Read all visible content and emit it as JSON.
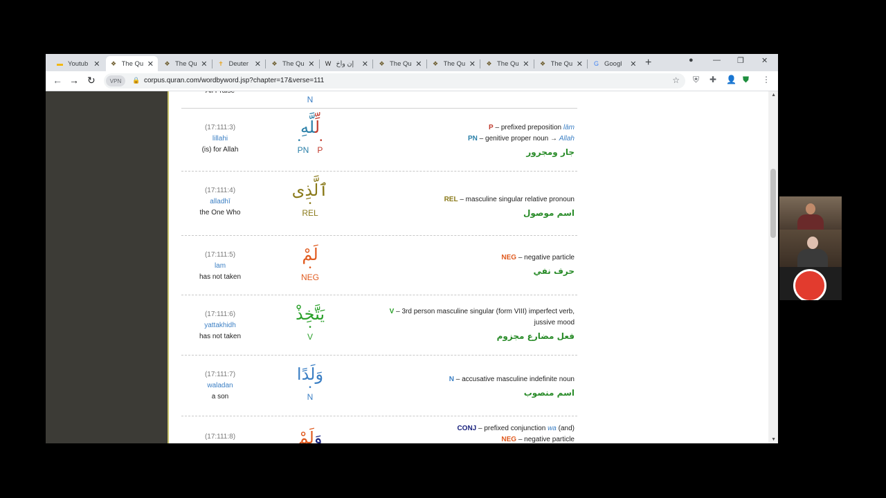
{
  "browser": {
    "tabs": [
      {
        "title": "Youtub",
        "favicon": "youtube-icon",
        "active": false
      },
      {
        "title": "The Qu",
        "favicon": "quran-book-icon",
        "active": true
      },
      {
        "title": "The Qu",
        "favicon": "quran-book-icon",
        "active": false
      },
      {
        "title": "Deuter",
        "favicon": "bible-icon",
        "active": false
      },
      {
        "title": "The Qu",
        "favicon": "quran-book-icon",
        "active": false
      },
      {
        "title": "إن وأخ",
        "favicon": "wikipedia-icon",
        "active": false
      },
      {
        "title": "The Qu",
        "favicon": "quran-book-icon",
        "active": false
      },
      {
        "title": "The Qu",
        "favicon": "quran-book-icon",
        "active": false
      },
      {
        "title": "The Qu",
        "favicon": "quran-book-icon",
        "active": false
      },
      {
        "title": "The Qu",
        "favicon": "quran-book-icon",
        "active": false
      },
      {
        "title": "Googl",
        "favicon": "google-translate-icon",
        "active": false
      }
    ],
    "vpn_label": "VPN",
    "url": "corpus.quran.com/wordbyword.jsp?chapter=17&verse=111"
  },
  "top_partial": {
    "tag": "N",
    "english": "All Praise"
  },
  "words": [
    {
      "location": "(17:111:3)",
      "translit": "lillahi",
      "english": "(is) for Allah",
      "arabic_a": "لِّ",
      "arabic_b": "لَّهِ",
      "color_a": "#c0392b",
      "color_b": "#2a7fa8",
      "tags": [
        {
          "t": "PN",
          "c": "#2a7fa8"
        },
        {
          "t": "P",
          "c": "#c0392b"
        }
      ],
      "gram": [
        {
          "tag": "P",
          "tag_color": "#c0392b",
          "text": " – prefixed preposition ",
          "ital": "lām",
          "ital_color": "#3b7fc4"
        },
        {
          "tag": "PN",
          "tag_color": "#2a7fa8",
          "text": " – genitive proper noun → ",
          "ital": "Allah",
          "ital_color": "#3b7fc4"
        }
      ],
      "arabic_gram": "جار ومجرور"
    },
    {
      "location": "(17:111:4)",
      "translit": "alladhī",
      "english": "the One Who",
      "arabic_a": "ٱلَّذِى",
      "arabic_b": "",
      "color_a": "#8a7a1a",
      "color_b": "#8a7a1a",
      "tags": [
        {
          "t": "REL",
          "c": "#8a7a1a"
        }
      ],
      "gram": [
        {
          "tag": "REL",
          "tag_color": "#8a7a1a",
          "text": " – masculine singular relative pronoun",
          "ital": "",
          "ital_color": ""
        }
      ],
      "arabic_gram": "اسم موصول"
    },
    {
      "location": "(17:111:5)",
      "translit": "lam",
      "english": "has not taken",
      "arabic_a": "لَمْ",
      "arabic_b": "",
      "color_a": "#e05a1e",
      "color_b": "#e05a1e",
      "tags": [
        {
          "t": "NEG",
          "c": "#e05a1e"
        }
      ],
      "gram": [
        {
          "tag": "NEG",
          "tag_color": "#e05a1e",
          "text": " – negative particle",
          "ital": "",
          "ital_color": ""
        }
      ],
      "arabic_gram": "حرف نفي"
    },
    {
      "location": "(17:111:6)",
      "translit": "yattakhidh",
      "english": "has not taken",
      "arabic_a": "يَتَّخِذْ",
      "arabic_b": "",
      "color_a": "#2aa02a",
      "color_b": "#2aa02a",
      "tags": [
        {
          "t": "V",
          "c": "#2aa02a"
        }
      ],
      "gram": [
        {
          "tag": "V",
          "tag_color": "#2aa02a",
          "text": " – 3rd person masculine singular (form VIII) imperfect verb,",
          "ital": "",
          "ital_color": ""
        },
        {
          "tag": "",
          "tag_color": "",
          "text": "jussive mood",
          "ital": "",
          "ital_color": ""
        }
      ],
      "arabic_gram": "فعل مضارع مجزوم"
    },
    {
      "location": "(17:111:7)",
      "translit": "waladan",
      "english": "a son",
      "arabic_a": "وَلَدًا",
      "arabic_b": "",
      "color_a": "#3b7fc4",
      "color_b": "#3b7fc4",
      "tags": [
        {
          "t": "N",
          "c": "#3b7fc4"
        }
      ],
      "gram": [
        {
          "tag": "N",
          "tag_color": "#3b7fc4",
          "text": " – accusative masculine indefinite noun",
          "ital": "",
          "ital_color": ""
        }
      ],
      "arabic_gram": "اسم منصوب"
    },
    {
      "location": "(17:111:8)",
      "translit": "",
      "english": "",
      "arabic_a": "وَ",
      "arabic_b": "لَمْ",
      "color_a": "#1a237e",
      "color_b": "#e05a1e",
      "tags": [],
      "gram": [
        {
          "tag": "CONJ",
          "tag_color": "#1a237e",
          "text": " – prefixed conjunction ",
          "ital": "wa",
          "ital_color": "#3b7fc4",
          "after": " (and)"
        },
        {
          "tag": "NEG",
          "tag_color": "#e05a1e",
          "text": " – negative particle",
          "ital": "",
          "ital_color": ""
        }
      ],
      "arabic_gram": ""
    }
  ]
}
